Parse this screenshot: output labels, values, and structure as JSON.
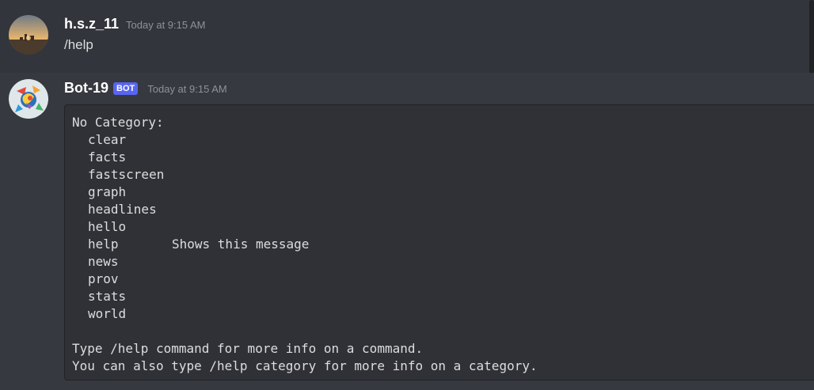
{
  "messages": [
    {
      "author": "h.s.z_11",
      "timestamp": "Today at 9:15 AM",
      "text": "/help",
      "avatar_icon": "sunset-landscape-avatar"
    },
    {
      "author": "Bot-19",
      "badge": "BOT",
      "timestamp": "Today at 9:15 AM",
      "avatar_icon": "colorful-bot-avatar",
      "code": {
        "category_header": "No Category:",
        "commands": [
          {
            "name": "clear",
            "description": ""
          },
          {
            "name": "facts",
            "description": ""
          },
          {
            "name": "fastscreen",
            "description": ""
          },
          {
            "name": "graph",
            "description": ""
          },
          {
            "name": "headlines",
            "description": ""
          },
          {
            "name": "hello",
            "description": ""
          },
          {
            "name": "help",
            "description": "Shows this message"
          },
          {
            "name": "news",
            "description": ""
          },
          {
            "name": "prov",
            "description": ""
          },
          {
            "name": "stats",
            "description": ""
          },
          {
            "name": "world",
            "description": ""
          }
        ],
        "footer_line_1": "Type /help command for more info on a command.",
        "footer_line_2": "You can also type /help category for more info on a category."
      }
    }
  ],
  "colors": {
    "background": "#36393f",
    "username": "#ffffff",
    "timestamp": "#8e9297",
    "bot_badge": "#5865f2",
    "code_bg": "#2f3136"
  }
}
